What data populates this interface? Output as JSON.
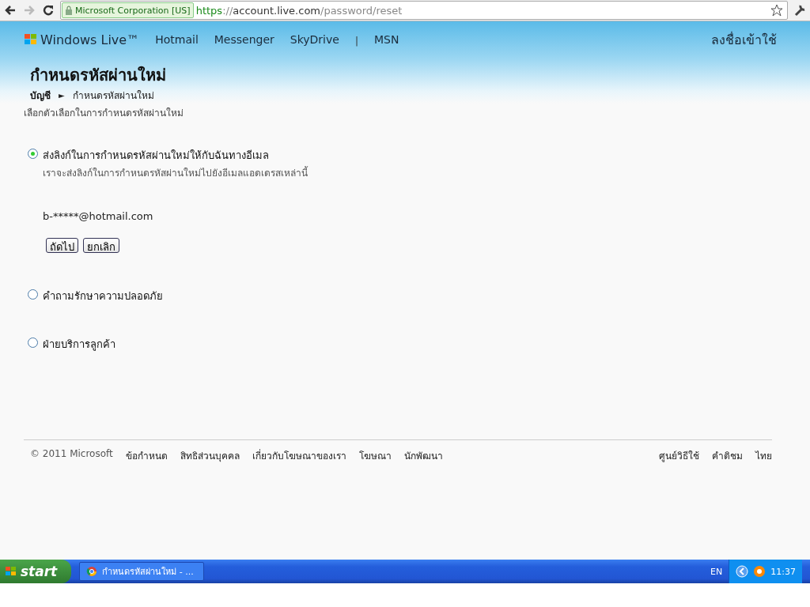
{
  "browser": {
    "identity": "Microsoft Corporation [US]",
    "url": {
      "scheme": "https",
      "separator": "://",
      "host": "account.live.com",
      "path": "/password/reset"
    }
  },
  "header": {
    "brand": "Windows Live™",
    "nav": [
      {
        "label": "Hotmail"
      },
      {
        "label": "Messenger"
      },
      {
        "label": "SkyDrive"
      },
      {
        "label": "MSN"
      }
    ],
    "separator": "|",
    "sign_in": "ลงชื่อเข้าใช้",
    "title": "กำหนดรหัสผ่านใหม่",
    "breadcrumb": {
      "parent": "บัญชี",
      "arrow": "►",
      "current": "กำหนดรหัสผ่านใหม่"
    }
  },
  "intro": "เลือกตัวเลือกในการกำหนดรหัสผ่านใหม่",
  "options": [
    {
      "label": "ส่งลิงก์ในการกำหนดรหัสผ่านใหม่ให้กับฉันทางอีเมล",
      "selected": true,
      "description": "เราจะส่งลิงก์ในการกำหนดรหัสผ่านใหม่ไปยังอีเมลแอดเดรสเหล่านี้",
      "email": "b-*****@hotmail.com",
      "buttons": [
        "ถัดไป",
        "ยกเลิก"
      ]
    },
    {
      "label": "คำถามรักษาความปลอดภัย",
      "selected": false
    },
    {
      "label": "ฝ่ายบริการลูกค้า",
      "selected": false
    }
  ],
  "footer": {
    "copyright": "© 2011 Microsoft",
    "links": [
      "ข้อกำหนด",
      "สิทธิส่วนบุคคล",
      "เกี่ยวกับโฆษณาของเรา",
      "โฆษณา",
      "นักพัฒนา"
    ],
    "right_links": [
      "ศูนย์วิธีใช้",
      "คำติชม",
      "ไทย"
    ]
  },
  "taskbar": {
    "start": "start",
    "window": "กำหนดรหัสผ่านใหม่ - ...",
    "language": "EN",
    "time": "11:37"
  }
}
